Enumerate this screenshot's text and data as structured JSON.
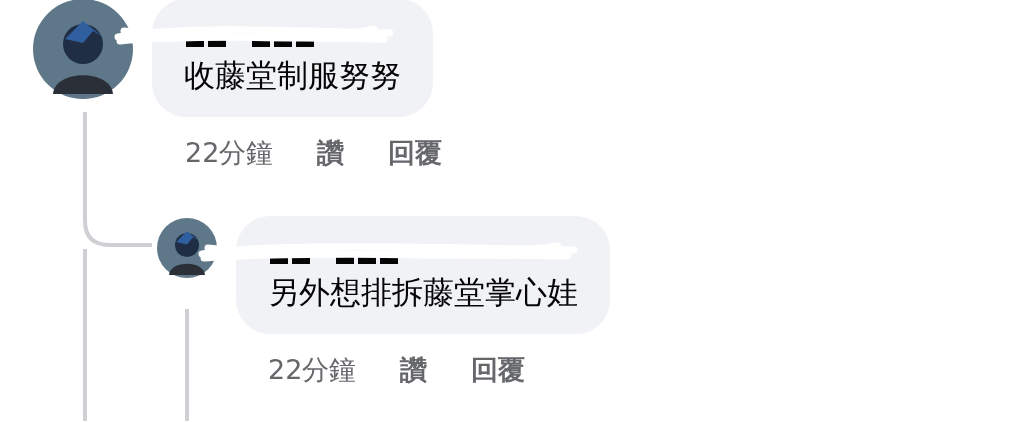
{
  "comments": [
    {
      "text": "收藤堂制服努努",
      "time": "22分鐘",
      "actions": [
        "讚",
        "回覆"
      ],
      "replies": [
        {
          "text": "另外想排拆藤堂掌心娃",
          "time": "22分鐘",
          "actions": [
            "讚",
            "回覆"
          ]
        }
      ]
    }
  ]
}
